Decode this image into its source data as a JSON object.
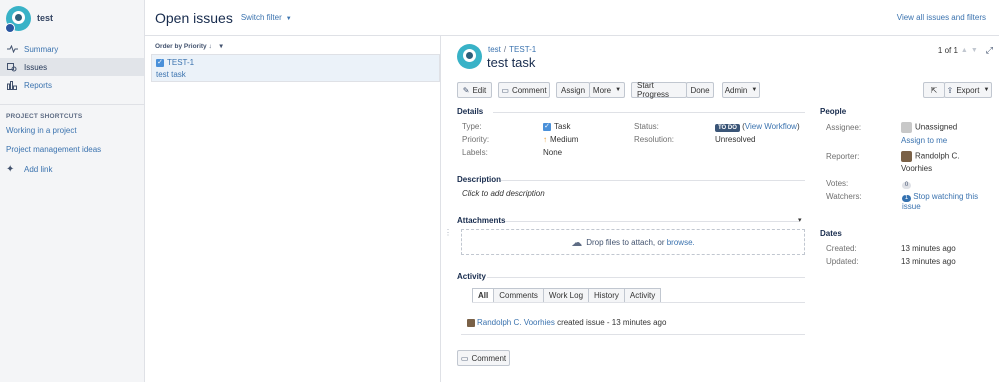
{
  "project": {
    "name": "test"
  },
  "sidebar": {
    "items": [
      {
        "label": "Summary",
        "icon": "pulse-icon"
      },
      {
        "label": "Issues",
        "icon": "issues-icon"
      },
      {
        "label": "Reports",
        "icon": "chart-icon"
      }
    ],
    "shortcuts_header": "PROJECT SHORTCUTS",
    "shortcuts": [
      "Working in a project",
      "Project management ideas"
    ],
    "add_link": "Add link"
  },
  "header": {
    "title": "Open issues",
    "switch_filter": "Switch filter",
    "view_all": "View all issues and filters"
  },
  "list": {
    "order_by": "Order by Priority",
    "issues": [
      {
        "key": "TEST-1",
        "summary": "test task"
      }
    ]
  },
  "issue": {
    "project": "test",
    "key": "TEST-1",
    "title": "test task",
    "pager": "1 of 1",
    "toolbar": {
      "edit": "Edit",
      "comment": "Comment",
      "assign": "Assign",
      "more": "More",
      "start_progress": "Start Progress",
      "done": "Done",
      "admin": "Admin",
      "export": "Export"
    },
    "details": {
      "header": "Details",
      "type_label": "Type:",
      "type_value": "Task",
      "priority_label": "Priority:",
      "priority_value": "Medium",
      "labels_label": "Labels:",
      "labels_value": "None",
      "status_label": "Status:",
      "status_value": "TO DO",
      "view_workflow": "View Workflow",
      "resolution_label": "Resolution:",
      "resolution_value": "Unresolved"
    },
    "description": {
      "header": "Description",
      "placeholder": "Click to add description"
    },
    "attachments": {
      "header": "Attachments",
      "drop_text": "Drop files to attach, or",
      "browse": "browse."
    },
    "activity": {
      "header": "Activity",
      "tabs": [
        "All",
        "Comments",
        "Work Log",
        "History",
        "Activity"
      ],
      "entry_user": "Randolph C. Voorhies",
      "entry_text": "created issue - 13 minutes ago"
    },
    "comment_button": "Comment",
    "people": {
      "header": "People",
      "assignee_label": "Assignee:",
      "assignee_value": "Unassigned",
      "assign_to_me": "Assign to me",
      "reporter_label": "Reporter:",
      "reporter_value_1": "Randolph C.",
      "reporter_value_2": "Voorhies",
      "votes_label": "Votes:",
      "votes_value": "0",
      "watchers_label": "Watchers:",
      "watchers_value": "1",
      "stop_watching_1": "Stop watching this",
      "stop_watching_2": "issue"
    },
    "dates": {
      "header": "Dates",
      "created_label": "Created:",
      "created_value": "13 minutes ago",
      "updated_label": "Updated:",
      "updated_value": "13 minutes ago"
    }
  },
  "colors": {
    "link": "#3b73af",
    "accent": "#38b2c7",
    "todo": "#3a5577"
  }
}
